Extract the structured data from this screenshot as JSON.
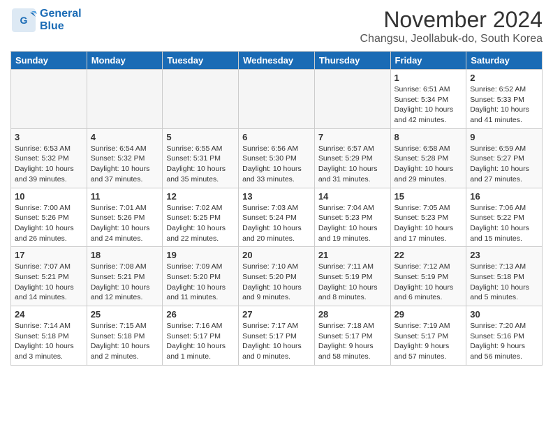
{
  "header": {
    "logo_line1": "General",
    "logo_line2": "Blue",
    "month": "November 2024",
    "location": "Changsu, Jeollabuk-do, South Korea"
  },
  "weekdays": [
    "Sunday",
    "Monday",
    "Tuesday",
    "Wednesday",
    "Thursday",
    "Friday",
    "Saturday"
  ],
  "weeks": [
    [
      {
        "day": "",
        "empty": true
      },
      {
        "day": "",
        "empty": true
      },
      {
        "day": "",
        "empty": true
      },
      {
        "day": "",
        "empty": true
      },
      {
        "day": "",
        "empty": true
      },
      {
        "day": "1",
        "sunrise": "6:51 AM",
        "sunset": "5:34 PM",
        "daylight": "10 hours and 42 minutes."
      },
      {
        "day": "2",
        "sunrise": "6:52 AM",
        "sunset": "5:33 PM",
        "daylight": "10 hours and 41 minutes."
      }
    ],
    [
      {
        "day": "3",
        "sunrise": "6:53 AM",
        "sunset": "5:32 PM",
        "daylight": "10 hours and 39 minutes."
      },
      {
        "day": "4",
        "sunrise": "6:54 AM",
        "sunset": "5:32 PM",
        "daylight": "10 hours and 37 minutes."
      },
      {
        "day": "5",
        "sunrise": "6:55 AM",
        "sunset": "5:31 PM",
        "daylight": "10 hours and 35 minutes."
      },
      {
        "day": "6",
        "sunrise": "6:56 AM",
        "sunset": "5:30 PM",
        "daylight": "10 hours and 33 minutes."
      },
      {
        "day": "7",
        "sunrise": "6:57 AM",
        "sunset": "5:29 PM",
        "daylight": "10 hours and 31 minutes."
      },
      {
        "day": "8",
        "sunrise": "6:58 AM",
        "sunset": "5:28 PM",
        "daylight": "10 hours and 29 minutes."
      },
      {
        "day": "9",
        "sunrise": "6:59 AM",
        "sunset": "5:27 PM",
        "daylight": "10 hours and 27 minutes."
      }
    ],
    [
      {
        "day": "10",
        "sunrise": "7:00 AM",
        "sunset": "5:26 PM",
        "daylight": "10 hours and 26 minutes."
      },
      {
        "day": "11",
        "sunrise": "7:01 AM",
        "sunset": "5:26 PM",
        "daylight": "10 hours and 24 minutes."
      },
      {
        "day": "12",
        "sunrise": "7:02 AM",
        "sunset": "5:25 PM",
        "daylight": "10 hours and 22 minutes."
      },
      {
        "day": "13",
        "sunrise": "7:03 AM",
        "sunset": "5:24 PM",
        "daylight": "10 hours and 20 minutes."
      },
      {
        "day": "14",
        "sunrise": "7:04 AM",
        "sunset": "5:23 PM",
        "daylight": "10 hours and 19 minutes."
      },
      {
        "day": "15",
        "sunrise": "7:05 AM",
        "sunset": "5:23 PM",
        "daylight": "10 hours and 17 minutes."
      },
      {
        "day": "16",
        "sunrise": "7:06 AM",
        "sunset": "5:22 PM",
        "daylight": "10 hours and 15 minutes."
      }
    ],
    [
      {
        "day": "17",
        "sunrise": "7:07 AM",
        "sunset": "5:21 PM",
        "daylight": "10 hours and 14 minutes."
      },
      {
        "day": "18",
        "sunrise": "7:08 AM",
        "sunset": "5:21 PM",
        "daylight": "10 hours and 12 minutes."
      },
      {
        "day": "19",
        "sunrise": "7:09 AM",
        "sunset": "5:20 PM",
        "daylight": "10 hours and 11 minutes."
      },
      {
        "day": "20",
        "sunrise": "7:10 AM",
        "sunset": "5:20 PM",
        "daylight": "10 hours and 9 minutes."
      },
      {
        "day": "21",
        "sunrise": "7:11 AM",
        "sunset": "5:19 PM",
        "daylight": "10 hours and 8 minutes."
      },
      {
        "day": "22",
        "sunrise": "7:12 AM",
        "sunset": "5:19 PM",
        "daylight": "10 hours and 6 minutes."
      },
      {
        "day": "23",
        "sunrise": "7:13 AM",
        "sunset": "5:18 PM",
        "daylight": "10 hours and 5 minutes."
      }
    ],
    [
      {
        "day": "24",
        "sunrise": "7:14 AM",
        "sunset": "5:18 PM",
        "daylight": "10 hours and 3 minutes."
      },
      {
        "day": "25",
        "sunrise": "7:15 AM",
        "sunset": "5:18 PM",
        "daylight": "10 hours and 2 minutes."
      },
      {
        "day": "26",
        "sunrise": "7:16 AM",
        "sunset": "5:17 PM",
        "daylight": "10 hours and 1 minute."
      },
      {
        "day": "27",
        "sunrise": "7:17 AM",
        "sunset": "5:17 PM",
        "daylight": "10 hours and 0 minutes."
      },
      {
        "day": "28",
        "sunrise": "7:18 AM",
        "sunset": "5:17 PM",
        "daylight": "9 hours and 58 minutes."
      },
      {
        "day": "29",
        "sunrise": "7:19 AM",
        "sunset": "5:17 PM",
        "daylight": "9 hours and 57 minutes."
      },
      {
        "day": "30",
        "sunrise": "7:20 AM",
        "sunset": "5:16 PM",
        "daylight": "9 hours and 56 minutes."
      }
    ]
  ]
}
